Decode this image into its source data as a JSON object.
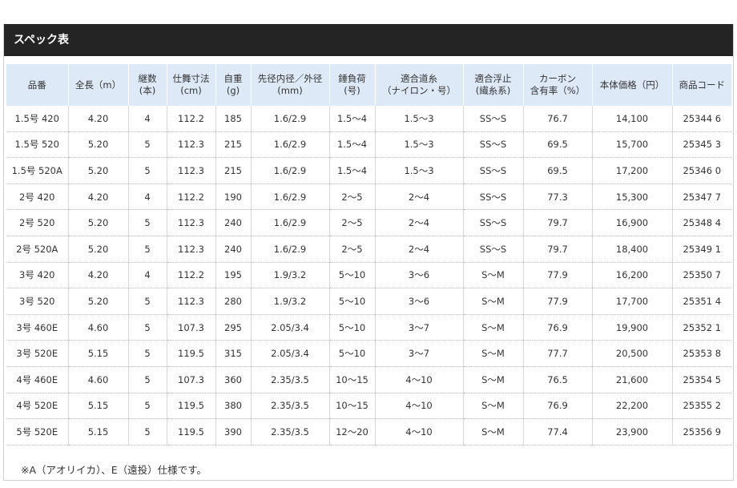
{
  "title": "スペック表",
  "headers": [
    [
      "品番"
    ],
    [
      "全長（m）"
    ],
    [
      "継数",
      "(本)"
    ],
    [
      "仕舞寸法",
      "(cm)"
    ],
    [
      "自重",
      "(g)"
    ],
    [
      "先径内径／外径",
      "(mm)"
    ],
    [
      "錘負荷",
      "(号)"
    ],
    [
      "適合道糸",
      "（ナイロン・号）"
    ],
    [
      "適合浮止",
      "(繊糸系)"
    ],
    [
      "カーボン",
      "含有率（%）"
    ],
    [
      "本体価格（円）"
    ],
    [
      "商品コード"
    ]
  ],
  "rows": [
    [
      "1.5号 420",
      "4.20",
      "4",
      "112.2",
      "185",
      "1.6/2.9",
      "1.5～4",
      "1.5～3",
      "SS～S",
      "76.7",
      "14,100",
      "25344 6"
    ],
    [
      "1.5号 520",
      "5.20",
      "5",
      "112.3",
      "215",
      "1.6/2.9",
      "1.5～4",
      "1.5～3",
      "SS～S",
      "69.5",
      "15,700",
      "25345 3"
    ],
    [
      "1.5号 520A",
      "5.20",
      "5",
      "112.3",
      "215",
      "1.6/2.9",
      "1.5～4",
      "1.5～3",
      "SS～S",
      "69.5",
      "17,200",
      "25346 0"
    ],
    [
      "2号 420",
      "4.20",
      "4",
      "112.2",
      "190",
      "1.6/2.9",
      "2～5",
      "2～4",
      "SS～S",
      "77.3",
      "15,300",
      "25347 7"
    ],
    [
      "2号 520",
      "5.20",
      "5",
      "112.3",
      "240",
      "1.6/2.9",
      "2～5",
      "2～4",
      "SS～S",
      "79.7",
      "16,900",
      "25348 4"
    ],
    [
      "2号 520A",
      "5.20",
      "5",
      "112.3",
      "240",
      "1.6/2.9",
      "2～5",
      "2～4",
      "SS～S",
      "79.7",
      "18,400",
      "25349 1"
    ],
    [
      "3号 420",
      "4.20",
      "4",
      "112.2",
      "195",
      "1.9/3.2",
      "5～10",
      "3～6",
      "S～M",
      "77.9",
      "16,200",
      "25350 7"
    ],
    [
      "3号 520",
      "5.20",
      "5",
      "112.3",
      "280",
      "1.9/3.2",
      "5～10",
      "3～6",
      "S～M",
      "77.9",
      "17,700",
      "25351 4"
    ],
    [
      "3号 460E",
      "4.60",
      "5",
      "107.3",
      "295",
      "2.05/3.4",
      "5～10",
      "3～7",
      "S～M",
      "76.9",
      "19,900",
      "25352 1"
    ],
    [
      "3号 520E",
      "5.15",
      "5",
      "119.5",
      "315",
      "2.05/3.4",
      "5～10",
      "3～7",
      "S～M",
      "77.7",
      "20,500",
      "25353 8"
    ],
    [
      "4号 460E",
      "4.60",
      "5",
      "107.3",
      "360",
      "2.35/3.5",
      "10～15",
      "4～10",
      "S～M",
      "76.5",
      "21,600",
      "25354 5"
    ],
    [
      "4号 520E",
      "5.15",
      "5",
      "119.5",
      "380",
      "2.35/3.5",
      "10～15",
      "4～10",
      "S～M",
      "76.9",
      "22,200",
      "25355 2"
    ],
    [
      "5号 520E",
      "5.15",
      "5",
      "119.5",
      "390",
      "2.35/3.5",
      "12～20",
      "4～10",
      "S～M",
      "77.4",
      "23,900",
      "25356 9"
    ]
  ],
  "note": "※A（アオリイカ）、E（遠投）仕様です。",
  "colors": {
    "header_bg": "#242424",
    "table_header_bg": "#dde9f7"
  }
}
